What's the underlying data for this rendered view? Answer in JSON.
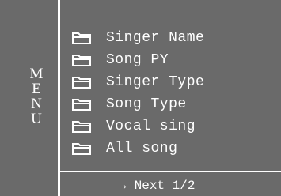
{
  "menu": {
    "title_letters": [
      "M",
      "E",
      "N",
      "U"
    ]
  },
  "items": [
    {
      "label": "Singer Name",
      "icon": "folder-icon"
    },
    {
      "label": "Song PY",
      "icon": "folder-icon"
    },
    {
      "label": "Singer Type",
      "icon": "folder-icon"
    },
    {
      "label": "Song Type",
      "icon": "folder-icon"
    },
    {
      "label": "Vocal sing",
      "icon": "folder-icon"
    },
    {
      "label": "All song",
      "icon": "folder-icon"
    }
  ],
  "footer": {
    "arrow": "→",
    "next_label": "Next 1/2"
  },
  "colors": {
    "background": "#6a6a6a",
    "foreground": "#ffffff"
  }
}
